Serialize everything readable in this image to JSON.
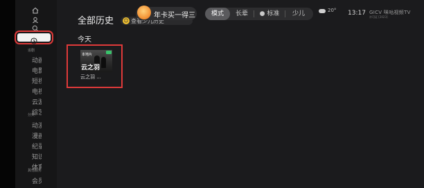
{
  "sidebar": {
    "active_item": "history",
    "heading_1": "追剧",
    "items_1": [
      "动画",
      "电影",
      "短视频",
      "电视剧",
      "云游戏",
      "综艺"
    ],
    "heading_2": "分类",
    "items_2": [
      "动漫",
      "漫画",
      "纪录片",
      "知识",
      "体育"
    ],
    "heading_3": "其他服务",
    "items_3": [
      "会员"
    ]
  },
  "header": {
    "title": "全部历史",
    "promo_chip": "查看少儿历史",
    "year_card": "年卡买一得三",
    "modes": [
      "模式",
      "长辈",
      "标准",
      "少儿"
    ],
    "weather_temp": "20°",
    "time": "13:17",
    "brand": "GICV 咪咕视频TV",
    "brand_sub": "许可证 [2023]"
  },
  "history": {
    "section": "今天",
    "items": [
      {
        "title": "云之羽 ...",
        "thumb_overlay": "云之羽",
        "thumb_tag": "本地片"
      }
    ]
  },
  "colors": {
    "highlight": "#e03a3a",
    "background": "#1b1b1d"
  }
}
